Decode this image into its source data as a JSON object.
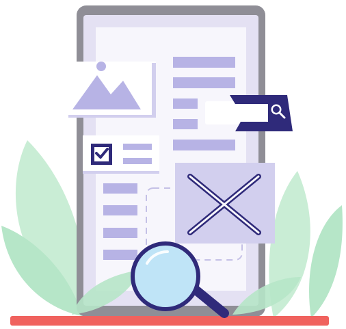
{
  "illustration": {
    "subject": "document-search-error",
    "palette": {
      "phone_frame": "#8F8E96",
      "phone_screen": "#E4E1F3",
      "card": "#F7F6FC",
      "lavender": "#B7B3E5",
      "lavender_light": "#D2CFEE",
      "navy": "#2F2A7A",
      "glass_fill": "#BFE4F7",
      "leaf_light": "#C9EDD5",
      "leaf_mid": "#A7E0BE",
      "floor": "#F0625E"
    },
    "icons": [
      "phone-icon",
      "image-placeholder-icon",
      "checkbox-checked-icon",
      "search-icon",
      "close-icon",
      "magnifying-glass-icon",
      "leaf-icon"
    ]
  }
}
